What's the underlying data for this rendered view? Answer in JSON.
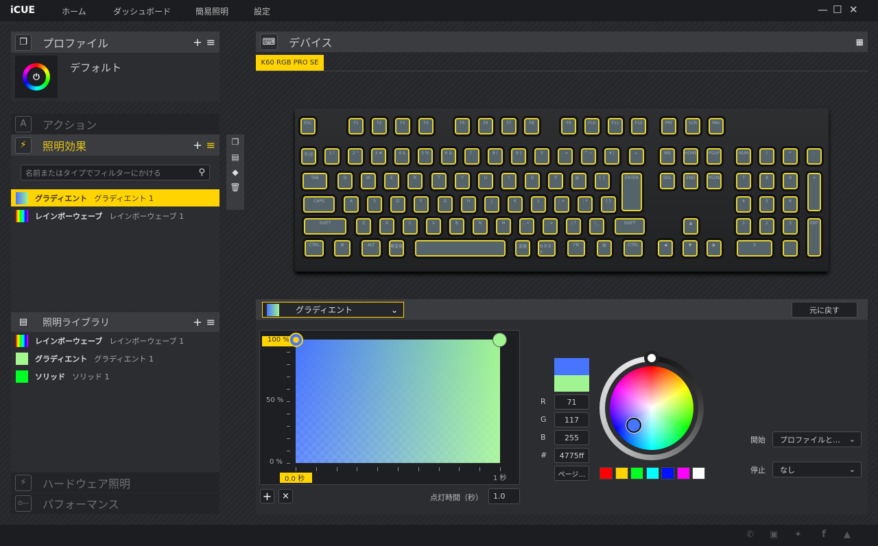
{
  "app": {
    "title": "iCUE",
    "nav": [
      "ホーム",
      "ダッシュボード",
      "簡易照明",
      "設定"
    ],
    "window_controls": [
      "minimize",
      "maximize",
      "close"
    ]
  },
  "profiles": {
    "title": "プロファイル",
    "add": "+",
    "menu": "≡",
    "current": "デフォルト"
  },
  "actions": {
    "title": "アクション"
  },
  "lighting_effects": {
    "title": "照明効果",
    "add": "+",
    "menu": "≡",
    "search_placeholder": "名前またはタイプでフィルターにかける",
    "items": [
      {
        "name": "グラディエント",
        "sub": "グラディエント 1",
        "selected": true
      },
      {
        "name": "レインボーウェーブ",
        "sub": "レインボーウェーブ 1",
        "selected": false
      }
    ]
  },
  "library": {
    "title": "照明ライブラリ",
    "add": "+",
    "menu": "≡",
    "items": [
      {
        "name": "レインボーウェーブ",
        "sub": "レインボーウェーブ 1",
        "color": "rainbow"
      },
      {
        "name": "グラディエント",
        "sub": "グラディエント 1",
        "color": "#a4f890"
      },
      {
        "name": "ソリッド",
        "sub": "ソリッド 1",
        "color": "#00ff22"
      }
    ]
  },
  "hardware_lighting": {
    "title": "ハードウェア照明"
  },
  "performance": {
    "title": "パフォーマンス"
  },
  "side_tools": [
    "copy-icon",
    "import-icon",
    "layer-icon",
    "trash-icon"
  ],
  "devices": {
    "title": "デバイス",
    "tab": "K60 RGB PRO SE"
  },
  "keyboard": {
    "keys": [
      "ESC",
      "F1",
      "F2",
      "F3",
      "F4",
      "F5",
      "F6",
      "F7",
      "F8",
      "F9",
      "F10",
      "F11",
      "F12",
      "PRT",
      "SCR",
      "PAU",
      "半/全",
      "1 !",
      "2 \"",
      "3 #",
      "4 $",
      "5 %",
      "6 &",
      "7 '",
      "8 (",
      "9 )",
      "0",
      "- =",
      "^ ~",
      "¥ |",
      "←",
      "INS",
      "HOME",
      "PGUP",
      "NUM",
      "/",
      "*",
      "-",
      "TAB",
      "Q",
      "W",
      "E",
      "R",
      "T",
      "Y",
      "U",
      "I",
      "O",
      "P",
      "@ `",
      "[ {",
      "ENTER",
      "DEL",
      "END",
      "PGDN",
      "7",
      "8",
      "9",
      "+",
      "CAPS",
      "A",
      "S",
      "D",
      "F",
      "G",
      "H",
      "J",
      "K",
      "L",
      "; +",
      ": *",
      "] }",
      "4",
      "5",
      "6",
      "SHIFT",
      "Z",
      "X",
      "C",
      "V",
      "B",
      "N",
      "M",
      ", <",
      ". >",
      "/ ?",
      "\\ _",
      "SHIFT",
      "▲",
      "1",
      "2",
      "3",
      "ENT",
      "CTRL",
      "⊞",
      "ALT",
      "無変換",
      "",
      "変換",
      "カタカナ",
      "FN",
      "▤",
      "CTRL",
      "◀",
      "▼",
      "▶",
      "0",
      "."
    ]
  },
  "effect": {
    "type": "グラディエント",
    "revert": "元に戻す"
  },
  "gradient": {
    "y_labels": [
      "100 %",
      "50 %",
      "0 %"
    ],
    "x_start": "0.0 秒",
    "x_end": "1 秒",
    "stops": [
      {
        "time": 0,
        "brightness": 100,
        "color": "#4775ff"
      },
      {
        "time": 1,
        "brightness": 100,
        "color": "#a0f592"
      }
    ],
    "add": "+",
    "remove": "×",
    "duration_label": "点灯時間（秒）",
    "duration": "1.0"
  },
  "color": {
    "r_label": "R",
    "g_label": "G",
    "b_label": "B",
    "hex_label": "#",
    "r": "71",
    "g": "117",
    "b": "255",
    "hex": "4775ff",
    "page_btn": "ページ…",
    "preview_top": "#4775ff",
    "preview_bottom": "#a0f592",
    "presets": [
      "#ff0000",
      "#ffd400",
      "#00ff22",
      "#00ffff",
      "#0011ff",
      "#ff00ff",
      "#ffffff"
    ]
  },
  "trigger": {
    "start_label": "開始",
    "start_value": "プロファイルと…",
    "stop_label": "停止",
    "stop_value": "なし"
  },
  "footer_icons": [
    "support-24-icon",
    "chat-icon",
    "twitter-icon",
    "facebook-icon",
    "corsair-icon"
  ]
}
